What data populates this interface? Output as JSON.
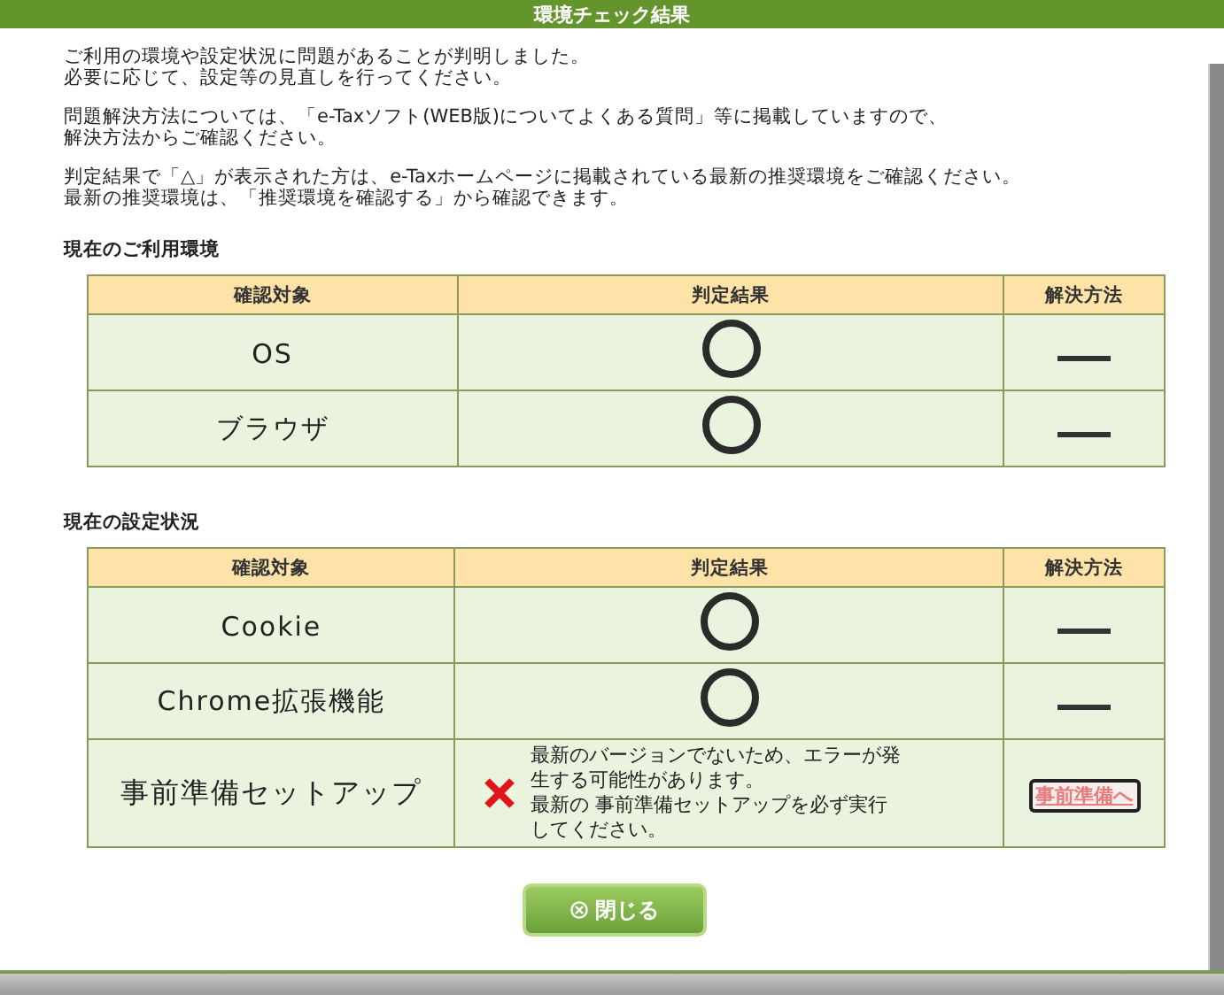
{
  "window": {
    "title": "環境チェック結果"
  },
  "intro": [
    [
      "ご利用の環境や設定状況に問題があることが判明しました。",
      "必要に応じて、設定等の見直しを行ってください。"
    ],
    [
      "問題解決方法については、「e-Taxソフト(WEB版)についてよくある質問」等に掲載していますので、",
      "解決方法からご確認ください。"
    ],
    [
      "判定結果で「△」が表示された方は、e-Taxホームページに掲載されている最新の推奨環境をご確認ください。",
      "最新の推奨環境は、「推奨環境を確認する」から確認できます。"
    ]
  ],
  "sections": [
    {
      "title": "現在のご利用環境",
      "columns": [
        "確認対象",
        "判定結果",
        "解決方法"
      ],
      "rows": [
        {
          "target": "OS",
          "result": {
            "kind": "ok"
          },
          "solution": {
            "kind": "none"
          }
        },
        {
          "target": "ブラウザ",
          "result": {
            "kind": "ok"
          },
          "solution": {
            "kind": "none"
          }
        }
      ]
    },
    {
      "title": "現在の設定状況",
      "columns": [
        "確認対象",
        "判定結果",
        "解決方法"
      ],
      "rows": [
        {
          "target": "Cookie",
          "result": {
            "kind": "ok"
          },
          "solution": {
            "kind": "none"
          }
        },
        {
          "target": "Chrome拡張機能",
          "result": {
            "kind": "ok"
          },
          "solution": {
            "kind": "none"
          }
        },
        {
          "target": "事前準備セットアップ",
          "result": {
            "kind": "ng",
            "message": [
              "最新のバージョンでないため、エラーが発生する可能性があります。",
              "最新の 事前準備セットアップを必ず実行してください。"
            ]
          },
          "solution": {
            "kind": "link",
            "label": "事前準備へ"
          }
        }
      ]
    }
  ],
  "close_button": {
    "label": "閉じる"
  }
}
